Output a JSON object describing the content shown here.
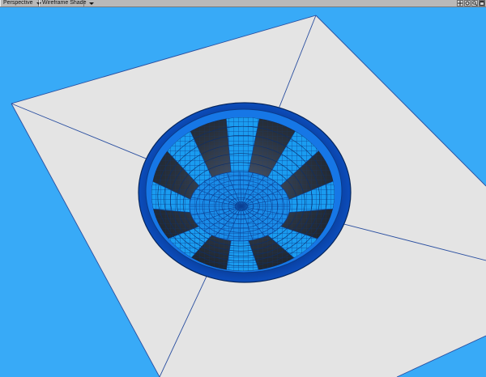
{
  "toolbar": {
    "view_mode": "Perspective",
    "shading_mode": "Wireframe Shade",
    "icons": [
      "move-icon",
      "rotate-icon",
      "zoom-icon",
      "maximize-icon"
    ]
  },
  "viewport": {
    "background_color": "#38aaf7",
    "ground_plane_color": "#e4e4e4",
    "edge_line_color": "#2a4fa0",
    "bowl_rim_color": "#0b4fc0",
    "bowl_inner_color": "#2e3744",
    "mesh_highlight_color": "#1a9cf0"
  }
}
